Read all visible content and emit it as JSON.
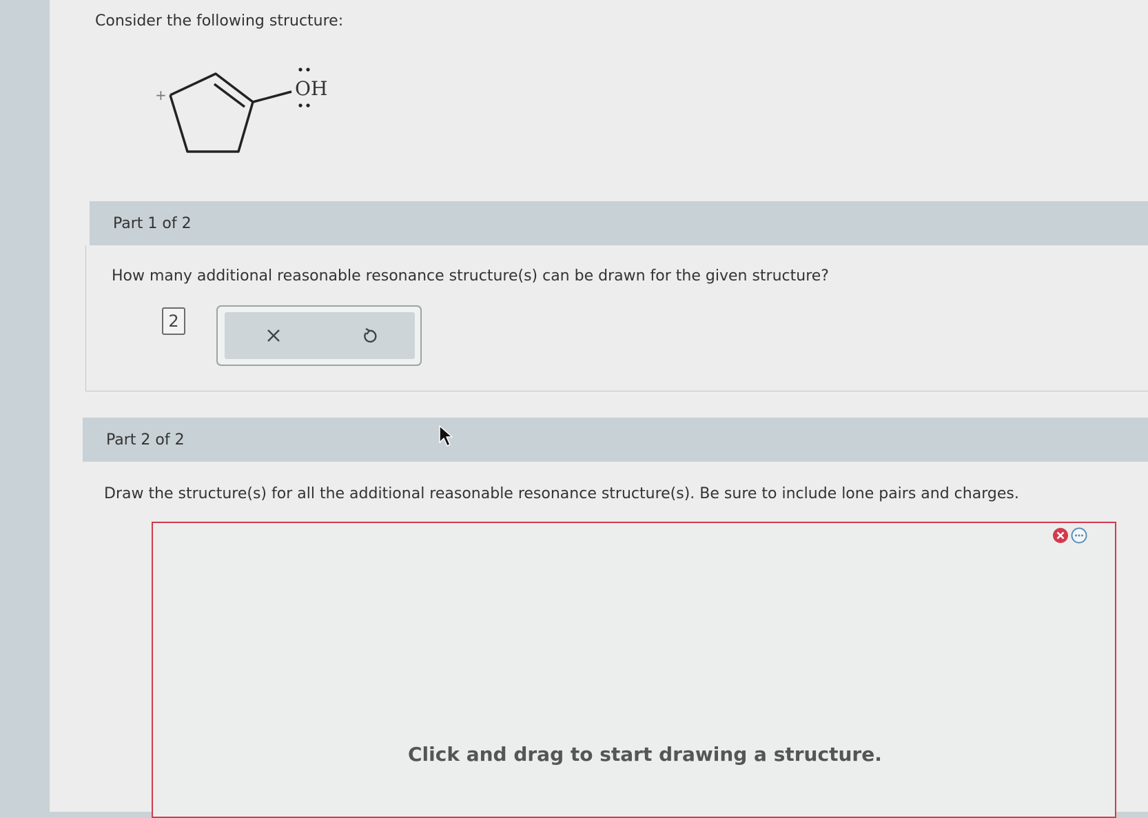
{
  "intro": {
    "text": "Consider the following structure:"
  },
  "molecule": {
    "charge": "+",
    "group": "OH"
  },
  "part1": {
    "header": "Part 1 of 2",
    "question": "How many additional reasonable resonance structure(s) can be drawn for the given structure?",
    "answer": "2",
    "clear_icon": "close-icon",
    "reset_icon": "undo-icon"
  },
  "part2": {
    "header": "Part 2 of 2",
    "instruction": "Draw the structure(s) for all the additional reasonable resonance structure(s). Be sure to include lone pairs and charges.",
    "draw_hint": "Click and drag to start drawing a structure."
  },
  "colors": {
    "error": "#d23a4e",
    "header_bg": "#c8d1d5",
    "info_blue": "#5b8fb9"
  }
}
